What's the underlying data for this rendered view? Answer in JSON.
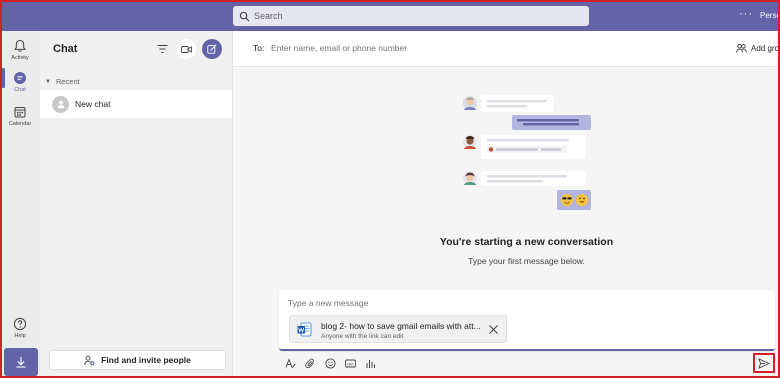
{
  "topbar": {
    "search_placeholder": "Search",
    "more_label": "···",
    "profile_label": "Person"
  },
  "rail": {
    "items": [
      {
        "label": "Activity",
        "icon": "bell-icon"
      },
      {
        "label": "Chat",
        "icon": "chat-icon"
      },
      {
        "label": "Calendar",
        "icon": "calendar-icon"
      },
      {
        "label": "Help",
        "icon": "help-icon"
      }
    ],
    "download_icon": "download-icon"
  },
  "chat_list": {
    "title": "Chat",
    "recent_label": "Recent",
    "items": [
      {
        "label": "New chat"
      }
    ],
    "invite_label": "Find and invite people"
  },
  "main": {
    "to_label": "To:",
    "to_placeholder": "Enter name, email or phone number",
    "add_group_label": "Add gro",
    "start_title": "You're starting a new conversation",
    "start_subtitle": "Type your first message below.",
    "compose_placeholder": "Type a new message",
    "attachment": {
      "name": "blog 2- how to save gmail emails with att...",
      "permission": "Anyone with the link can edit"
    },
    "toolbar_icons": [
      "format-icon",
      "attach-icon",
      "emoji-icon",
      "gif-icon",
      "poll-icon"
    ]
  },
  "colors": {
    "brand": "#6264a7",
    "highlight_border": "#d32027",
    "word_blue": "#185abd"
  }
}
